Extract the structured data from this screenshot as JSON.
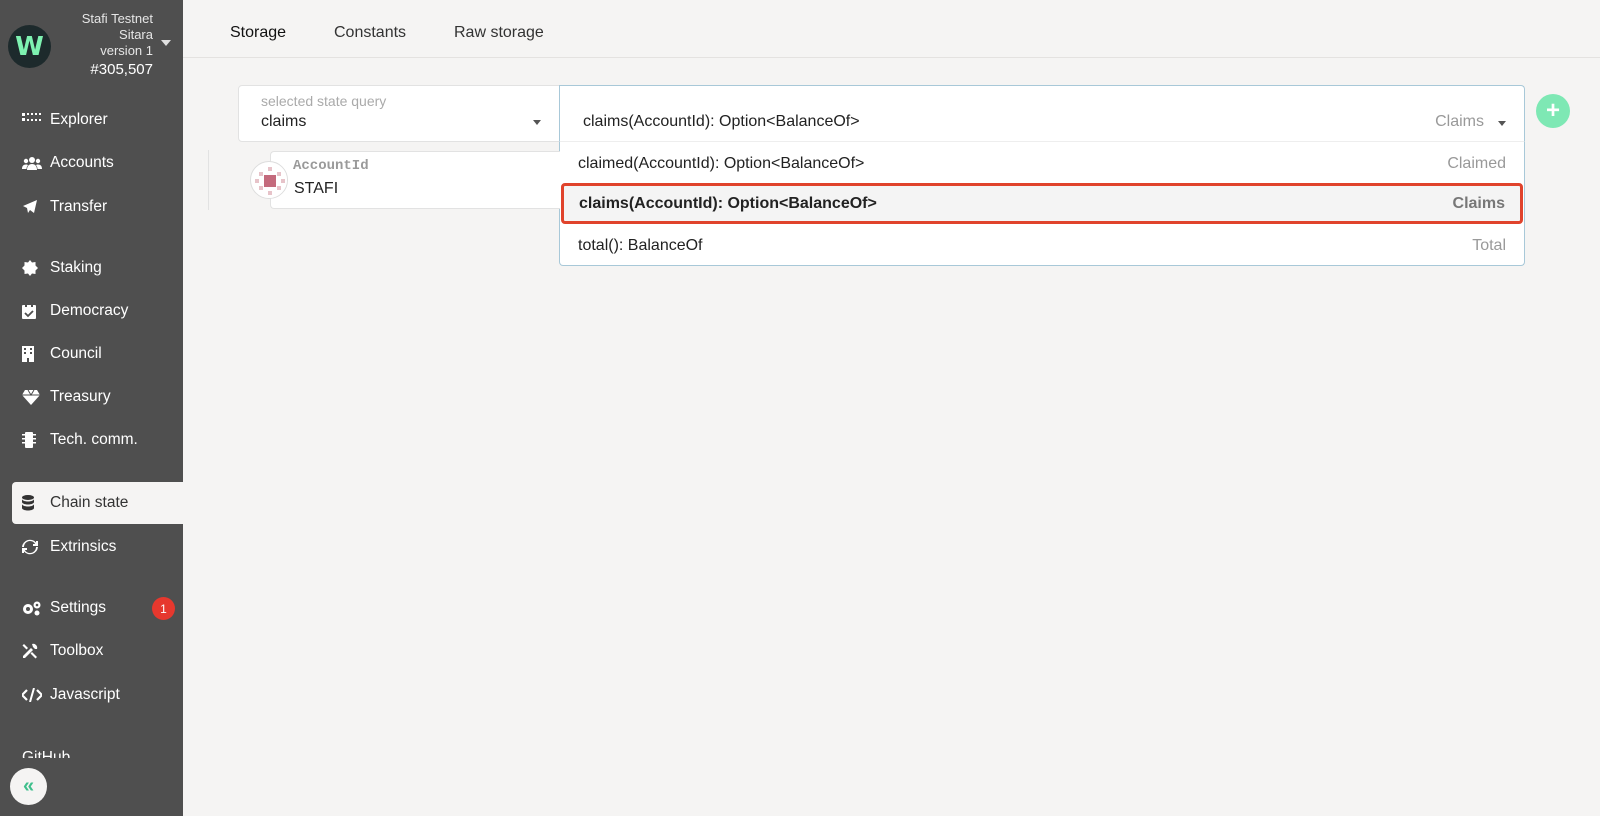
{
  "chain": {
    "name_line1": "Stafi Testnet",
    "name_line2": "Sitara",
    "version": "version 1",
    "block": "#305,507",
    "logo_letter": "W"
  },
  "nav": {
    "items": [
      {
        "label": "Explorer",
        "icon": "explorer-icon"
      },
      {
        "label": "Accounts",
        "icon": "users-icon"
      },
      {
        "label": "Transfer",
        "icon": "paper-plane-icon"
      },
      {
        "label": "Staking",
        "icon": "certificate-icon"
      },
      {
        "label": "Democracy",
        "icon": "calendar-check-icon"
      },
      {
        "label": "Council",
        "icon": "building-icon"
      },
      {
        "label": "Treasury",
        "icon": "gem-icon"
      },
      {
        "label": "Tech. comm.",
        "icon": "microchip-icon"
      },
      {
        "label": "Chain state",
        "icon": "database-icon"
      },
      {
        "label": "Extrinsics",
        "icon": "sync-icon"
      },
      {
        "label": "Settings",
        "icon": "cogs-icon",
        "badge": "1"
      },
      {
        "label": "Toolbox",
        "icon": "tools-icon"
      },
      {
        "label": "Javascript",
        "icon": "code-icon"
      }
    ],
    "partial_item": "GitHub",
    "collapse_glyph": "«"
  },
  "tabs": [
    "Storage",
    "Constants",
    "Raw storage"
  ],
  "query": {
    "label": "selected state query",
    "module": "claims",
    "method": "claims(AccountId): Option<BalanceOf>",
    "method_section": "Claims"
  },
  "dropdown": {
    "options": [
      {
        "method": "claimed(AccountId): Option<BalanceOf>",
        "section": "Claimed"
      },
      {
        "method": "claims(AccountId): Option<BalanceOf>",
        "section": "Claims"
      },
      {
        "method": "total(): BalanceOf",
        "section": "Total"
      }
    ]
  },
  "param": {
    "label": "AccountId",
    "value": "STAFI"
  },
  "add_button_glyph": "+",
  "colors": {
    "sidebar": "#4f4f4f",
    "accent_green": "#7ee8b4",
    "highlight_border": "#e0432c",
    "badge_red": "#e6382e"
  }
}
